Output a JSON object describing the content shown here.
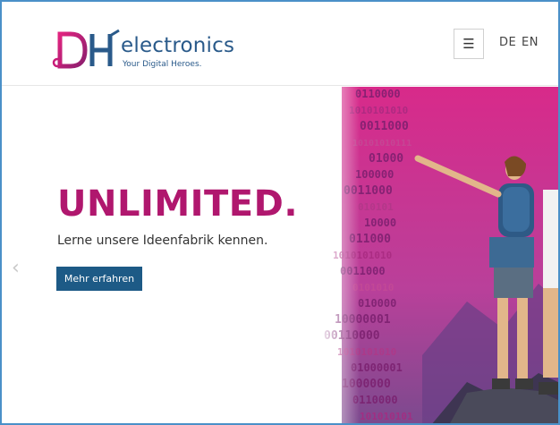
{
  "header": {
    "brand_word": "electronics",
    "brand_tagline": "Your Digital Heroes.",
    "menu_icon": "☰",
    "lang_de": "DE",
    "lang_en": "EN"
  },
  "hero": {
    "headline": "UNLIMITED.",
    "subline": "Lerne unsere Ideenfabrik kennen.",
    "cta_label": "Mehr erfahren",
    "prev_arrow": "‹"
  },
  "colors": {
    "brand_magenta": "#b0176e",
    "brand_blue": "#2a5a8a",
    "cta_blue": "#1d5a86"
  },
  "icons": [
    "hamburger-menu-icon",
    "chevron-left-icon",
    "dh-logo-icon"
  ]
}
